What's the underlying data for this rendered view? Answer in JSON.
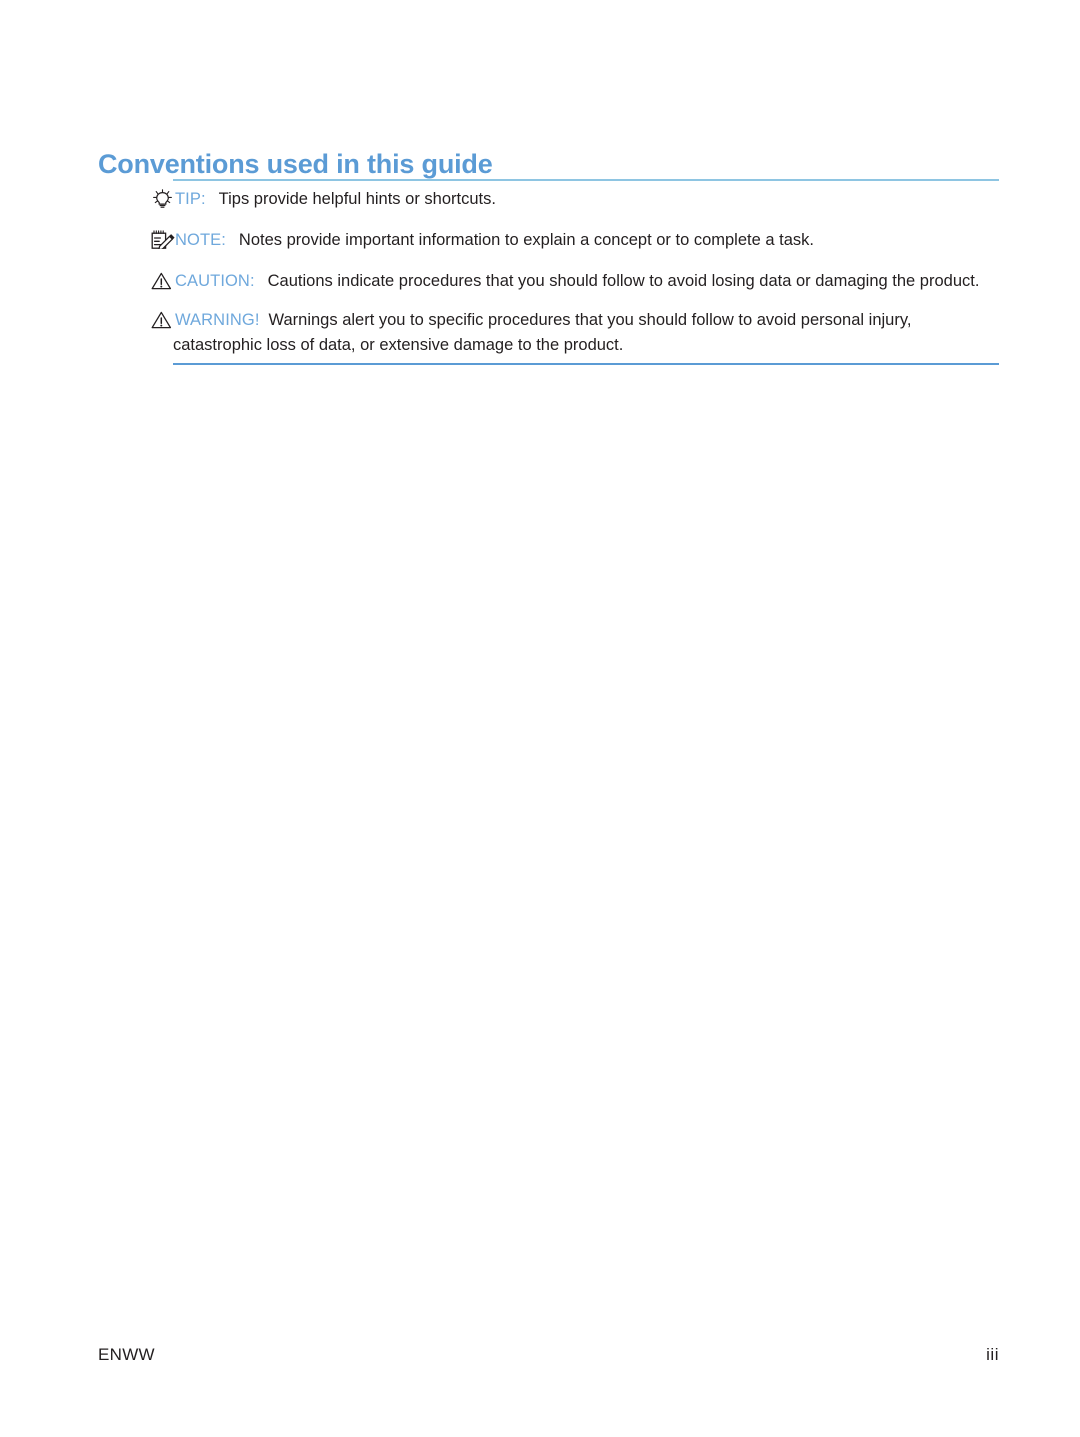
{
  "document": {
    "heading": "Conventions used in this guide"
  },
  "colors": {
    "heading": "#5b9bd5",
    "label": "#6fa8dc",
    "rule_top": "#8ec5e2",
    "rule_bottom": "#5b9bd5",
    "body_text": "#231f20"
  },
  "notices": [
    {
      "icon": "lightbulb-icon",
      "label": "TIP:",
      "text": "Tips provide helpful hints or shortcuts."
    },
    {
      "icon": "notepad-pencil-icon",
      "label": "NOTE:",
      "text": "Notes provide important information to explain a concept or to complete a task."
    },
    {
      "icon": "warning-triangle-icon",
      "label": "CAUTION:",
      "text": "Cautions indicate procedures that you should follow to avoid losing data or damaging the product."
    },
    {
      "icon": "warning-triangle-icon",
      "label": "WARNING!",
      "text": "Warnings alert you to specific procedures that you should follow to avoid personal injury, catastrophic loss of data, or extensive damage to the product."
    }
  ],
  "footer": {
    "left": "ENWW",
    "page_number": "iii"
  }
}
